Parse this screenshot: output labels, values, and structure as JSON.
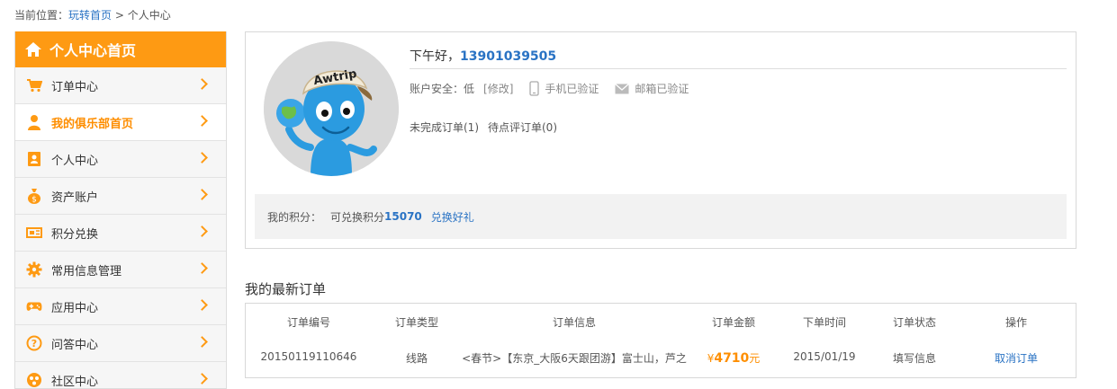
{
  "breadcrumb": {
    "prefix": "当前位置：",
    "home": "玩转首页",
    "sep": " > ",
    "current": "个人中心"
  },
  "sidebar": {
    "header": "个人中心首页",
    "items": [
      {
        "label": "订单中心",
        "icon": "cart-icon"
      },
      {
        "label": "我的俱乐部首页",
        "icon": "person-icon",
        "active": true
      },
      {
        "label": "个人中心",
        "icon": "contact-card-icon"
      },
      {
        "label": "资产账户",
        "icon": "money-bag-icon"
      },
      {
        "label": "积分兑换",
        "icon": "ticket-icon"
      },
      {
        "label": "常用信息管理",
        "icon": "gear-icon"
      },
      {
        "label": "应用中心",
        "icon": "gamepad-icon"
      },
      {
        "label": "问答中心",
        "icon": "question-icon"
      },
      {
        "label": "社区中心",
        "icon": "community-icon"
      }
    ]
  },
  "profile": {
    "greeting": "下午好，",
    "phone": "13901039505",
    "security_label": "账户安全：",
    "security_level": "低",
    "modify": "[修改]",
    "phone_verified": "手机已验证",
    "email_verified": "邮箱已验证",
    "unfinished_orders": "未完成订单(1)",
    "pending_review": "待点评订单(0)",
    "points_label": "我的积分：",
    "redeemable_label": "可兑换积分",
    "points_value": "15070",
    "redeem_link": "兑换好礼",
    "avatar_cap_text": "Awtrip"
  },
  "orders": {
    "title": "我的最新订单",
    "columns": [
      "订单编号",
      "订单类型",
      "订单信息",
      "订单金额",
      "下单时间",
      "订单状态",
      "操作"
    ],
    "rows": [
      {
        "id": "20150119110646",
        "type": "线路",
        "info": "<春节>【东京_大阪6天跟团游】富士山，芦之",
        "currency": "¥",
        "amount": "4710",
        "unit": "元",
        "date": "2015/01/19",
        "status": "填写信息",
        "action": "取消订单"
      }
    ]
  },
  "colors": {
    "accent": "#fe9a13",
    "link": "#2a73c4",
    "price": "#fe8e00"
  }
}
